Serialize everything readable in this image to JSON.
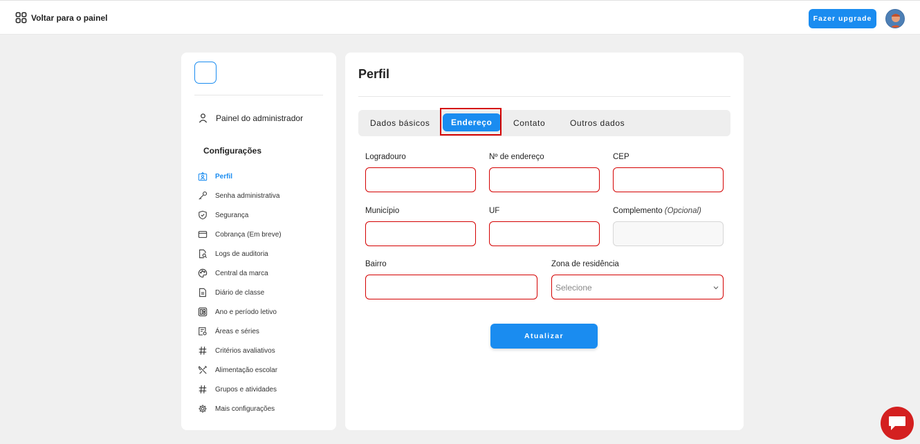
{
  "topbar": {
    "back_label": "Voltar para o painel",
    "upgrade_label": "Fazer upgrade"
  },
  "sidebar": {
    "admin_label": "Painel do administrador",
    "section_title": "Configurações",
    "items": [
      {
        "label": "Perfil",
        "icon": "profile-icon",
        "active": true
      },
      {
        "label": "Senha administrativa",
        "icon": "key-icon"
      },
      {
        "label": "Segurança",
        "icon": "shield-icon"
      },
      {
        "label": "Cobrança (Em breve)",
        "icon": "card-icon"
      },
      {
        "label": "Logs de auditoria",
        "icon": "audit-log-icon"
      },
      {
        "label": "Central da marca",
        "icon": "palette-icon"
      },
      {
        "label": "Diário de classe",
        "icon": "document-icon"
      },
      {
        "label": "Ano e período letivo",
        "icon": "calendar-grid-icon"
      },
      {
        "label": "Áreas e séries",
        "icon": "areas-icon"
      },
      {
        "label": "Critérios avaliativos",
        "icon": "hash-icon"
      },
      {
        "label": "Alimentação escolar",
        "icon": "utensils-icon"
      },
      {
        "label": "Grupos e atividades",
        "icon": "hash-icon"
      },
      {
        "label": "Mais configurações",
        "icon": "gear-icon"
      }
    ]
  },
  "main": {
    "title": "Perfil",
    "tabs": [
      "Dados básicos",
      "Endereço",
      "Contato",
      "Outros dados"
    ],
    "active_tab": "Endereço",
    "form": {
      "logradouro_label": "Logradouro",
      "numero_label": "Nº de endereço",
      "cep_label": "CEP",
      "municipio_label": "Município",
      "uf_label": "UF",
      "complemento_label": "Complemento",
      "complemento_hint": "(Opcional)",
      "bairro_label": "Bairro",
      "zona_label": "Zona de residência",
      "zona_value": "Selecione",
      "submit_label": "Atualizar"
    }
  },
  "colors": {
    "accent": "#1a8cf0",
    "error": "#d40000",
    "chat": "#d42020"
  }
}
